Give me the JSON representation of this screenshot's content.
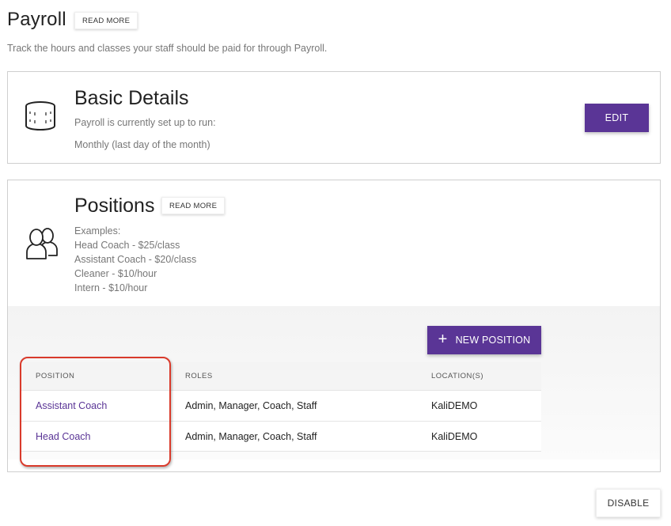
{
  "header": {
    "title": "Payroll",
    "read_more": "READ MORE",
    "subtitle": "Track the hours and classes your staff should be paid for through Payroll."
  },
  "basic_details": {
    "icon": "coins-stack-icon",
    "title": "Basic Details",
    "line1": "Payroll is currently set up to run:",
    "line2": "Monthly (last day of the month)",
    "edit_label": "EDIT"
  },
  "positions": {
    "icon": "users-icon",
    "title": "Positions",
    "read_more": "READ MORE",
    "examples_label": "Examples:",
    "examples": [
      "Head Coach - $25/class",
      "Assistant Coach - $20/class",
      "Cleaner - $10/hour",
      "Intern - $10/hour"
    ],
    "new_position_label": "NEW POSITION",
    "table": {
      "columns": [
        "POSITION",
        "ROLES",
        "LOCATION(S)"
      ],
      "rows": [
        {
          "position": "Assistant Coach",
          "roles": "Admin, Manager, Coach, Staff",
          "location": "KaliDEMO"
        },
        {
          "position": "Head Coach",
          "roles": "Admin, Manager, Coach, Staff",
          "location": "KaliDEMO"
        }
      ]
    }
  },
  "footer": {
    "disable_label": "DISABLE"
  },
  "colors": {
    "accent": "#5a3596",
    "highlight": "#d93a2b"
  }
}
